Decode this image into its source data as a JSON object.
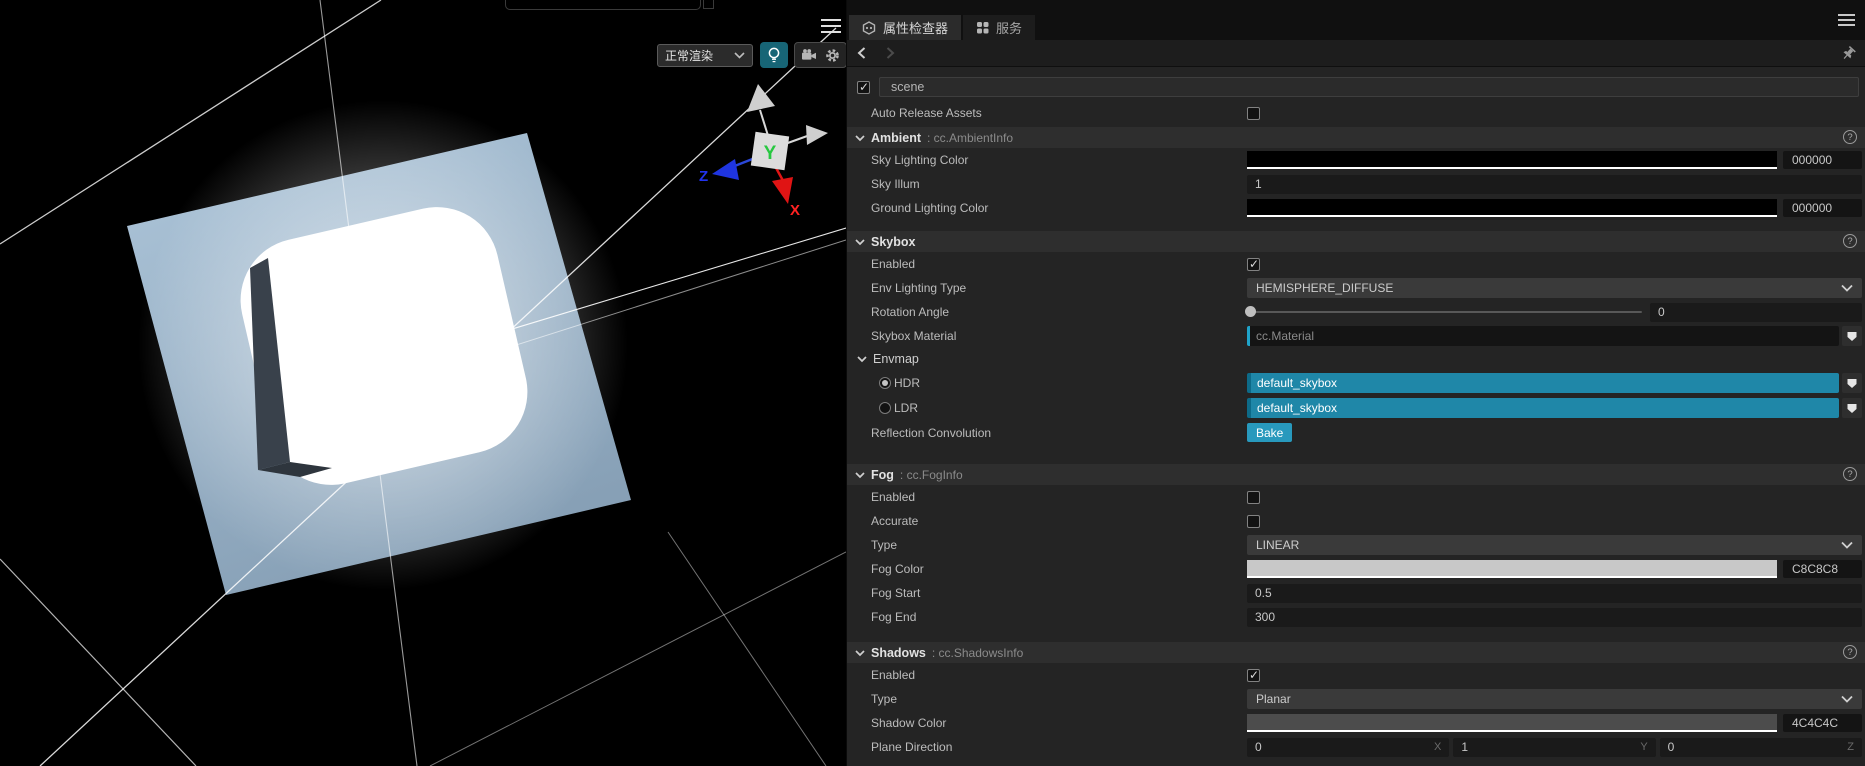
{
  "viewport": {
    "render_mode": "正常渲染",
    "gizmo": {
      "x": "X",
      "y": "Y",
      "z": "Z"
    }
  },
  "icons": {
    "help": "?"
  },
  "tabs": {
    "inspector": "属性检查器",
    "services": "服务"
  },
  "inspector": {
    "scene_name": "scene",
    "auto_release_label": "Auto Release Assets",
    "ambient": {
      "title": "Ambient",
      "cls": ": cc.AmbientInfo",
      "sky_lighting_color": {
        "label": "Sky Lighting Color",
        "hex": "000000",
        "color": "#000000"
      },
      "sky_illum": {
        "label": "Sky Illum",
        "value": "1"
      },
      "ground_lighting_color": {
        "label": "Ground Lighting Color",
        "hex": "000000",
        "color": "#000000"
      }
    },
    "skybox": {
      "title": "Skybox",
      "enabled": {
        "label": "Enabled",
        "checked": true
      },
      "env_lighting_type": {
        "label": "Env Lighting Type",
        "value": "HEMISPHERE_DIFFUSE"
      },
      "rotation_angle": {
        "label": "Rotation Angle",
        "value": "0"
      },
      "skybox_material": {
        "label": "Skybox Material",
        "value": "cc.Material"
      },
      "envmap_title": "Envmap",
      "hdr": {
        "label": "HDR",
        "value": "default_skybox",
        "selected": true
      },
      "ldr": {
        "label": "LDR",
        "value": "default_skybox",
        "selected": false
      },
      "reflection_convolution": {
        "label": "Reflection Convolution",
        "button": "Bake"
      }
    },
    "fog": {
      "title": "Fog",
      "cls": ": cc.FogInfo",
      "enabled": {
        "label": "Enabled",
        "checked": false
      },
      "accurate": {
        "label": "Accurate",
        "checked": false
      },
      "type": {
        "label": "Type",
        "value": "LINEAR"
      },
      "fog_color": {
        "label": "Fog Color",
        "hex": "C8C8C8",
        "color": "#C8C8C8"
      },
      "fog_start": {
        "label": "Fog Start",
        "value": "0.5"
      },
      "fog_end": {
        "label": "Fog End",
        "value": "300"
      }
    },
    "shadows": {
      "title": "Shadows",
      "cls": ": cc.ShadowsInfo",
      "enabled": {
        "label": "Enabled",
        "checked": true
      },
      "type": {
        "label": "Type",
        "value": "Planar"
      },
      "shadow_color": {
        "label": "Shadow Color",
        "hex": "4C4C4C",
        "color": "#4C4C4C"
      },
      "plane_direction": {
        "label": "Plane Direction",
        "x": {
          "value": "0",
          "axis": "X"
        },
        "y": {
          "value": "1",
          "axis": "Y"
        },
        "z": {
          "value": "0",
          "axis": "Z"
        }
      }
    }
  },
  "colors": {
    "accent_teal": "#2899BD",
    "asset_teal": "#1F87A8",
    "light_button_teal": "#176576"
  }
}
